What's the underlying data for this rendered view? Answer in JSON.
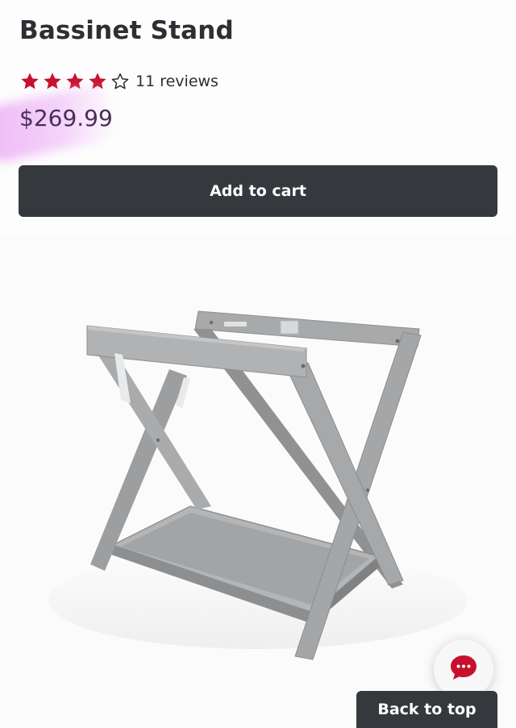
{
  "product": {
    "title": "Bassinet Stand",
    "rating": 4,
    "rating_max": 5,
    "reviews_label": "11 reviews",
    "price": "$269.99"
  },
  "actions": {
    "add_to_cart_label": "Add to cart",
    "back_to_top_label": "Back to top"
  },
  "icons": {
    "star_filled": "star-filled-icon",
    "star_empty": "star-outline-icon",
    "chat": "chat-bubble-icon"
  },
  "colors": {
    "star": "#c8102e",
    "button_bg": "#35393d",
    "price_text": "#4a2d5a",
    "highlight": "#eeb3f5",
    "chat_icon": "#c8102e"
  }
}
